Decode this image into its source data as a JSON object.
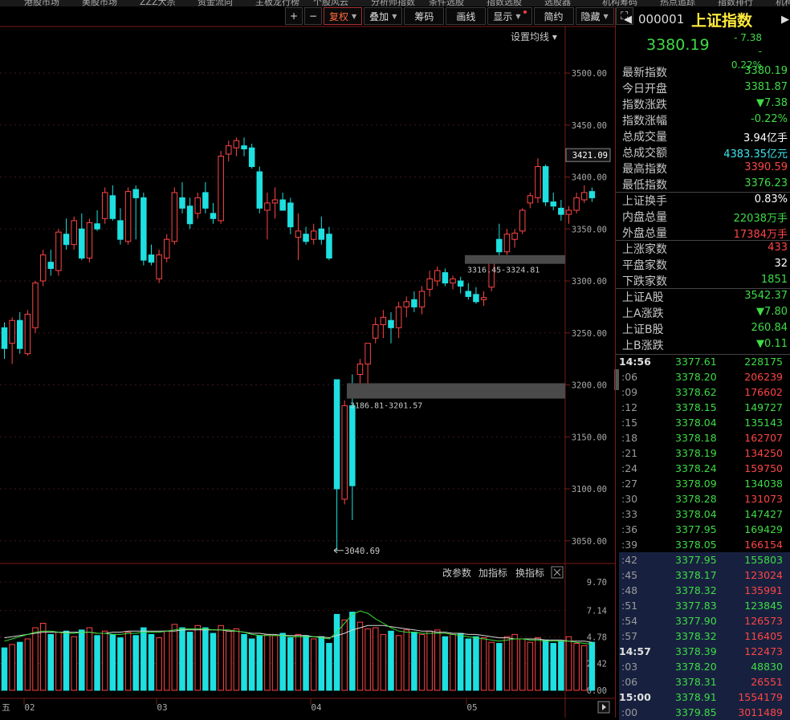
{
  "topnav": [
    "港股市场",
    "美股市场",
    "ZZZ大宗",
    "资金流向",
    "主板龙行榜",
    "个股风云",
    "分析师指数",
    "条件选股",
    "指数选股",
    "选股器",
    "机构筹码",
    "热点追踪",
    "指数排行",
    "机构"
  ],
  "toolbar": {
    "plus": "+",
    "minus": "−",
    "fuquan": "复权",
    "diejia": "叠加",
    "chouma": "筹码",
    "huaxian": "画线",
    "xianshi": "显示",
    "jianyue": "简约",
    "yincang": "隐藏",
    "settings_label": "设置均线"
  },
  "colors": {
    "up": "#ff4545",
    "down": "#1ee0e0",
    "ma": "#d8d8d8",
    "ma2": "#38e038",
    "accent": "#ffeb3b",
    "green": "#3fdc46"
  },
  "chart_data": {
    "type": "candlestick",
    "yticks": [
      3500.0,
      3450.0,
      3400.0,
      3350.0,
      3300.0,
      3250.0,
      3200.0,
      3150.0,
      3100.0,
      3050.0
    ],
    "ylim": [
      3030,
      3540
    ],
    "x_labels": [
      "02",
      "03",
      "04",
      "05"
    ],
    "current_price_label": "3421.09",
    "min_marker": "3040.69",
    "gap_labels": [
      "3186.81-3201.57",
      "3316.45-3324.81"
    ],
    "candles": [
      {
        "o": 3255,
        "h": 3260,
        "l": 3225,
        "c": 3235
      },
      {
        "o": 3240,
        "h": 3265,
        "l": 3220,
        "c": 3262
      },
      {
        "o": 3262,
        "h": 3270,
        "l": 3230,
        "c": 3235
      },
      {
        "o": 3230,
        "h": 3272,
        "l": 3228,
        "c": 3268
      },
      {
        "o": 3255,
        "h": 3300,
        "l": 3250,
        "c": 3298
      },
      {
        "o": 3300,
        "h": 3330,
        "l": 3295,
        "c": 3325
      },
      {
        "o": 3318,
        "h": 3330,
        "l": 3305,
        "c": 3312
      },
      {
        "o": 3310,
        "h": 3350,
        "l": 3305,
        "c": 3347
      },
      {
        "o": 3345,
        "h": 3360,
        "l": 3330,
        "c": 3335
      },
      {
        "o": 3335,
        "h": 3362,
        "l": 3330,
        "c": 3358
      },
      {
        "o": 3350,
        "h": 3365,
        "l": 3320,
        "c": 3322
      },
      {
        "o": 3322,
        "h": 3360,
        "l": 3318,
        "c": 3356
      },
      {
        "o": 3355,
        "h": 3368,
        "l": 3348,
        "c": 3350
      },
      {
        "o": 3360,
        "h": 3390,
        "l": 3355,
        "c": 3385
      },
      {
        "o": 3382,
        "h": 3392,
        "l": 3358,
        "c": 3360
      },
      {
        "o": 3358,
        "h": 3370,
        "l": 3335,
        "c": 3340
      },
      {
        "o": 3338,
        "h": 3390,
        "l": 3335,
        "c": 3386
      },
      {
        "o": 3388,
        "h": 3392,
        "l": 3340,
        "c": 3380
      },
      {
        "o": 3380,
        "h": 3385,
        "l": 3315,
        "c": 3320
      },
      {
        "o": 3325,
        "h": 3335,
        "l": 3315,
        "c": 3318
      },
      {
        "o": 3302,
        "h": 3330,
        "l": 3298,
        "c": 3325
      },
      {
        "o": 3322,
        "h": 3345,
        "l": 3318,
        "c": 3340
      },
      {
        "o": 3338,
        "h": 3390,
        "l": 3335,
        "c": 3385
      },
      {
        "o": 3380,
        "h": 3395,
        "l": 3365,
        "c": 3370
      },
      {
        "o": 3372,
        "h": 3380,
        "l": 3350,
        "c": 3355
      },
      {
        "o": 3365,
        "h": 3385,
        "l": 3360,
        "c": 3380
      },
      {
        "o": 3385,
        "h": 3395,
        "l": 3365,
        "c": 3370
      },
      {
        "o": 3365,
        "h": 3375,
        "l": 3355,
        "c": 3360
      },
      {
        "o": 3358,
        "h": 3425,
        "l": 3355,
        "c": 3420
      },
      {
        "o": 3422,
        "h": 3435,
        "l": 3415,
        "c": 3430
      },
      {
        "o": 3428,
        "h": 3438,
        "l": 3420,
        "c": 3435
      },
      {
        "o": 3430,
        "h": 3438,
        "l": 3420,
        "c": 3427
      },
      {
        "o": 3428,
        "h": 3432,
        "l": 3408,
        "c": 3410
      },
      {
        "o": 3405,
        "h": 3410,
        "l": 3365,
        "c": 3370
      },
      {
        "o": 3368,
        "h": 3385,
        "l": 3340,
        "c": 3375
      },
      {
        "o": 3375,
        "h": 3390,
        "l": 3360,
        "c": 3378
      },
      {
        "o": 3378,
        "h": 3385,
        "l": 3370,
        "c": 3368
      },
      {
        "o": 3375,
        "h": 3380,
        "l": 3345,
        "c": 3352
      },
      {
        "o": 3342,
        "h": 3365,
        "l": 3320,
        "c": 3348
      },
      {
        "o": 3345,
        "h": 3352,
        "l": 3335,
        "c": 3338
      },
      {
        "o": 3340,
        "h": 3355,
        "l": 3335,
        "c": 3348
      },
      {
        "o": 3350,
        "h": 3362,
        "l": 3335,
        "c": 3340
      },
      {
        "o": 3345,
        "h": 3352,
        "l": 3320,
        "c": 3322
      },
      {
        "o": 3205,
        "h": 3205,
        "l": 3040.69,
        "c": 3100
      },
      {
        "o": 3090,
        "h": 3185,
        "l": 3085,
        "c": 3180
      },
      {
        "o": 3180,
        "h": 3210,
        "l": 3070,
        "c": 3103
      },
      {
        "o": 3210,
        "h": 3225,
        "l": 3187,
        "c": 3220
      },
      {
        "o": 3220,
        "h": 3240,
        "l": 3200,
        "c": 3240
      },
      {
        "o": 3245,
        "h": 3265,
        "l": 3240,
        "c": 3258
      },
      {
        "o": 3258,
        "h": 3272,
        "l": 3245,
        "c": 3265
      },
      {
        "o": 3262,
        "h": 3270,
        "l": 3240,
        "c": 3255
      },
      {
        "o": 3255,
        "h": 3280,
        "l": 3245,
        "c": 3275
      },
      {
        "o": 3275,
        "h": 3285,
        "l": 3265,
        "c": 3280
      },
      {
        "o": 3282,
        "h": 3290,
        "l": 3270,
        "c": 3275
      },
      {
        "o": 3275,
        "h": 3295,
        "l": 3268,
        "c": 3290
      },
      {
        "o": 3292,
        "h": 3310,
        "l": 3285,
        "c": 3302
      },
      {
        "o": 3300,
        "h": 3314,
        "l": 3295,
        "c": 3310
      },
      {
        "o": 3308,
        "h": 3312,
        "l": 3295,
        "c": 3298
      },
      {
        "o": 3298,
        "h": 3305,
        "l": 3292,
        "c": 3302
      },
      {
        "o": 3300,
        "h": 3304,
        "l": 3288,
        "c": 3295
      },
      {
        "o": 3290,
        "h": 3298,
        "l": 3282,
        "c": 3285
      },
      {
        "o": 3287,
        "h": 3294,
        "l": 3278,
        "c": 3280
      },
      {
        "o": 3282,
        "h": 3290,
        "l": 3276,
        "c": 3284
      },
      {
        "o": 3294,
        "h": 3320,
        "l": 3290,
        "c": 3317
      },
      {
        "o": 3340,
        "h": 3355,
        "l": 3322,
        "c": 3328
      },
      {
        "o": 3328,
        "h": 3350,
        "l": 3325,
        "c": 3345
      },
      {
        "o": 3340,
        "h": 3350,
        "l": 3332,
        "c": 3346
      },
      {
        "o": 3348,
        "h": 3370,
        "l": 3345,
        "c": 3368
      },
      {
        "o": 3375,
        "h": 3385,
        "l": 3370,
        "c": 3382
      },
      {
        "o": 3380,
        "h": 3418,
        "l": 3375,
        "c": 3410
      },
      {
        "o": 3410,
        "h": 3412,
        "l": 3372,
        "c": 3376
      },
      {
        "o": 3376,
        "h": 3385,
        "l": 3368,
        "c": 3372
      },
      {
        "o": 3370,
        "h": 3378,
        "l": 3358,
        "c": 3364
      },
      {
        "o": 3364,
        "h": 3372,
        "l": 3355,
        "c": 3368
      },
      {
        "o": 3368,
        "h": 3385,
        "l": 3365,
        "c": 3380
      },
      {
        "o": 3378,
        "h": 3392,
        "l": 3375,
        "c": 3385
      },
      {
        "o": 3386,
        "h": 3390,
        "l": 3376,
        "c": 3380
      }
    ],
    "ma_line": [
      3250,
      3252,
      3256,
      3262,
      3270,
      3280,
      3292,
      3305,
      3315,
      3325,
      3330,
      3335,
      3340,
      3345,
      3352,
      3358,
      3362,
      3366,
      3368,
      3368,
      3366,
      3362,
      3360,
      3362,
      3366,
      3370,
      3372,
      3374,
      3378,
      3386,
      3395,
      3402,
      3406,
      3400,
      3392,
      3386,
      3380,
      3375,
      3368,
      3362,
      3356,
      3350,
      3345,
      3300,
      3250,
      3208,
      3180,
      3170,
      3175,
      3185,
      3198,
      3212,
      3228,
      3245,
      3258,
      3268,
      3276,
      3282,
      3288,
      3290,
      3292,
      3294,
      3296,
      3300,
      3308,
      3318,
      3328,
      3338,
      3348,
      3360,
      3366,
      3368,
      3368,
      3370,
      3372,
      3374,
      3376
    ],
    "volume": {
      "yticks": [
        9.7,
        7.14,
        4.78,
        2.42,
        0.0
      ],
      "bars": [
        3.8,
        4.1,
        4.3,
        4.6,
        5.6,
        6.0,
        5.0,
        5.2,
        5.3,
        4.8,
        5.4,
        5.6,
        4.9,
        5.3,
        5.0,
        4.7,
        5.2,
        4.9,
        5.6,
        5.0,
        4.7,
        5.3,
        5.9,
        5.6,
        5.2,
        5.8,
        5.6,
        5.1,
        5.8,
        5.3,
        5.5,
        5.0,
        4.6,
        4.9,
        5.0,
        4.9,
        5.1,
        4.7,
        5.0,
        4.9,
        4.6,
        4.8,
        4.2,
        6.8,
        6.3,
        7.0,
        6.1,
        5.5,
        5.6,
        5.0,
        5.3,
        4.9,
        5.4,
        5.2,
        5.0,
        5.3,
        5.4,
        4.8,
        5.0,
        5.1,
        4.6,
        4.8,
        4.7,
        4.3,
        4.2,
        4.8,
        5.0,
        4.6,
        4.3,
        4.7,
        4.5,
        4.2,
        4.4,
        4.8,
        4.2,
        4.0,
        4.3
      ],
      "ma_white": [
        4.7,
        4.8,
        4.9,
        5.0,
        5.1,
        5.2,
        5.2,
        5.2,
        5.2,
        5.2,
        5.2,
        5.2,
        5.1,
        5.1,
        5.2,
        5.2,
        5.3,
        5.3,
        5.3,
        5.3,
        5.3,
        5.3,
        5.3,
        5.4,
        5.4,
        5.4,
        5.4,
        5.4,
        5.4,
        5.3,
        5.3,
        5.2,
        5.1,
        5.1,
        5.0,
        5.0,
        4.9,
        4.9,
        4.9,
        4.9,
        4.8,
        4.8,
        4.7,
        4.9,
        5.1,
        5.4,
        5.6,
        5.8,
        5.8,
        5.8,
        5.7,
        5.6,
        5.5,
        5.4,
        5.3,
        5.3,
        5.2,
        5.2,
        5.1,
        5.1,
        5.0,
        5.0,
        4.9,
        4.8,
        4.7,
        4.7,
        4.6,
        4.6,
        4.6,
        4.6,
        4.5,
        4.5,
        4.5,
        4.4,
        4.4,
        4.4,
        4.3
      ],
      "ma_green": [
        4.4,
        4.6,
        4.8,
        5.0,
        5.2,
        5.3,
        5.3,
        5.2,
        5.1,
        5.1,
        5.2,
        5.2,
        5.1,
        5.1,
        5.0,
        5.0,
        5.1,
        5.1,
        5.2,
        5.2,
        5.2,
        5.3,
        5.4,
        5.5,
        5.5,
        5.5,
        5.5,
        5.4,
        5.4,
        5.4,
        5.3,
        5.2,
        5.0,
        4.9,
        4.9,
        4.9,
        4.9,
        4.8,
        4.8,
        4.8,
        4.8,
        4.7,
        4.6,
        5.2,
        6.0,
        6.8,
        7.1,
        6.9,
        6.4,
        6.0,
        5.6,
        5.3,
        5.2,
        5.2,
        5.1,
        5.1,
        5.1,
        5.1,
        5.0,
        4.9,
        4.8,
        4.7,
        4.6,
        4.5,
        4.4,
        4.5,
        4.6,
        4.6,
        4.5,
        4.5,
        4.4,
        4.4,
        4.4,
        4.4,
        4.3,
        4.2,
        4.1
      ]
    },
    "volume_buttons": [
      "改参数",
      "加指标",
      "换指标"
    ],
    "bottom_left_text": "五"
  },
  "quote": {
    "code": "000001",
    "name": "上证指数",
    "price": "3380.19",
    "change": "- 7.38",
    "pct": "- 0.22%",
    "rows": [
      {
        "label": "最新指数",
        "value": "3380.19",
        "color": "#3fdc46"
      },
      {
        "label": "今日开盘",
        "value": "3381.87",
        "color": "#3fdc46"
      },
      {
        "label": "指数涨跌",
        "value": "▼7.38",
        "color": "#3fdc46"
      },
      {
        "label": "指数涨幅",
        "value": "-0.22%",
        "color": "#3fdc46"
      },
      {
        "label": "总成交量",
        "value": "3.94亿手",
        "color": "#ffffff"
      },
      {
        "label": "总成交额",
        "value": "4383.35亿元",
        "color": "#3ee8f0"
      },
      {
        "label": "最高指数",
        "value": "3390.59",
        "color": "#ff4545"
      },
      {
        "label": "最低指数",
        "value": "3376.23",
        "color": "#3fdc46"
      },
      {
        "label": "上证换手",
        "value": "0.83%",
        "color": "#ffffff"
      },
      {
        "label": "内盘总量",
        "value": "22038万手",
        "color": "#3fdc46"
      },
      {
        "label": "外盘总量",
        "value": "17384万手",
        "color": "#ff4545"
      },
      {
        "label": "上涨家数",
        "value": "433",
        "color": "#ff4545"
      },
      {
        "label": "平盘家数",
        "value": "32",
        "color": "#ffffff"
      },
      {
        "label": "下跌家数",
        "value": "1851",
        "color": "#3fdc46"
      },
      {
        "label": "上证A股",
        "value": "3542.37",
        "color": "#3fdc46"
      },
      {
        "label": "上A涨跌",
        "value": "▼7.80",
        "color": "#3fdc46"
      },
      {
        "label": "上证B股",
        "value": "260.84",
        "color": "#3fdc46"
      },
      {
        "label": "上B涨跌",
        "value": "▼0.11",
        "color": "#3fdc46"
      }
    ],
    "ticks": [
      {
        "t": "14:56",
        "p": "3377.61",
        "v": "228175",
        "c": "#3fdc46",
        "sel": false,
        "bold": true
      },
      {
        "t": ":06",
        "p": "3378.20",
        "v": "206239",
        "c": "#ff4545",
        "sel": false
      },
      {
        "t": ":09",
        "p": "3378.62",
        "v": "176602",
        "c": "#ff4545",
        "sel": false
      },
      {
        "t": ":12",
        "p": "3378.15",
        "v": "149727",
        "c": "#3fdc46",
        "sel": false
      },
      {
        "t": ":15",
        "p": "3378.04",
        "v": "135143",
        "c": "#3fdc46",
        "sel": false
      },
      {
        "t": ":18",
        "p": "3378.18",
        "v": "162707",
        "c": "#ff4545",
        "sel": false
      },
      {
        "t": ":21",
        "p": "3378.19",
        "v": "134250",
        "c": "#ff4545",
        "sel": false
      },
      {
        "t": ":24",
        "p": "3378.24",
        "v": "159750",
        "c": "#ff4545",
        "sel": false
      },
      {
        "t": ":27",
        "p": "3378.09",
        "v": "134038",
        "c": "#3fdc46",
        "sel": false
      },
      {
        "t": ":30",
        "p": "3378.28",
        "v": "131073",
        "c": "#ff4545",
        "sel": false
      },
      {
        "t": ":33",
        "p": "3378.04",
        "v": "147427",
        "c": "#3fdc46",
        "sel": false
      },
      {
        "t": ":36",
        "p": "3377.95",
        "v": "169429",
        "c": "#3fdc46",
        "sel": false
      },
      {
        "t": ":39",
        "p": "3378.05",
        "v": "166154",
        "c": "#ff4545",
        "sel": false
      },
      {
        "t": ":42",
        "p": "3377.95",
        "v": "155803",
        "c": "#3fdc46",
        "sel": true
      },
      {
        "t": ":45",
        "p": "3378.17",
        "v": "123024",
        "c": "#ff4545",
        "sel": true
      },
      {
        "t": ":48",
        "p": "3378.32",
        "v": "135991",
        "c": "#ff4545",
        "sel": true
      },
      {
        "t": ":51",
        "p": "3377.83",
        "v": "123845",
        "c": "#3fdc46",
        "sel": true
      },
      {
        "t": ":54",
        "p": "3377.90",
        "v": "126573",
        "c": "#ff4545",
        "sel": true
      },
      {
        "t": ":57",
        "p": "3378.32",
        "v": "116405",
        "c": "#ff4545",
        "sel": true
      },
      {
        "t": "14:57",
        "p": "3378.39",
        "v": "122473",
        "c": "#ff4545",
        "sel": true,
        "bold": true
      },
      {
        "t": ":03",
        "p": "3378.20",
        "v": "48830",
        "c": "#3fdc46",
        "sel": true
      },
      {
        "t": ":06",
        "p": "3378.31",
        "v": "26551",
        "c": "#ff4545",
        "sel": true
      },
      {
        "t": "15:00",
        "p": "3378.91",
        "v": "1554179",
        "c": "#ff4545",
        "sel": true,
        "bold": true
      },
      {
        "t": ":00",
        "p": "3379.85",
        "v": "3011489",
        "c": "#ff4545",
        "sel": true
      }
    ]
  }
}
